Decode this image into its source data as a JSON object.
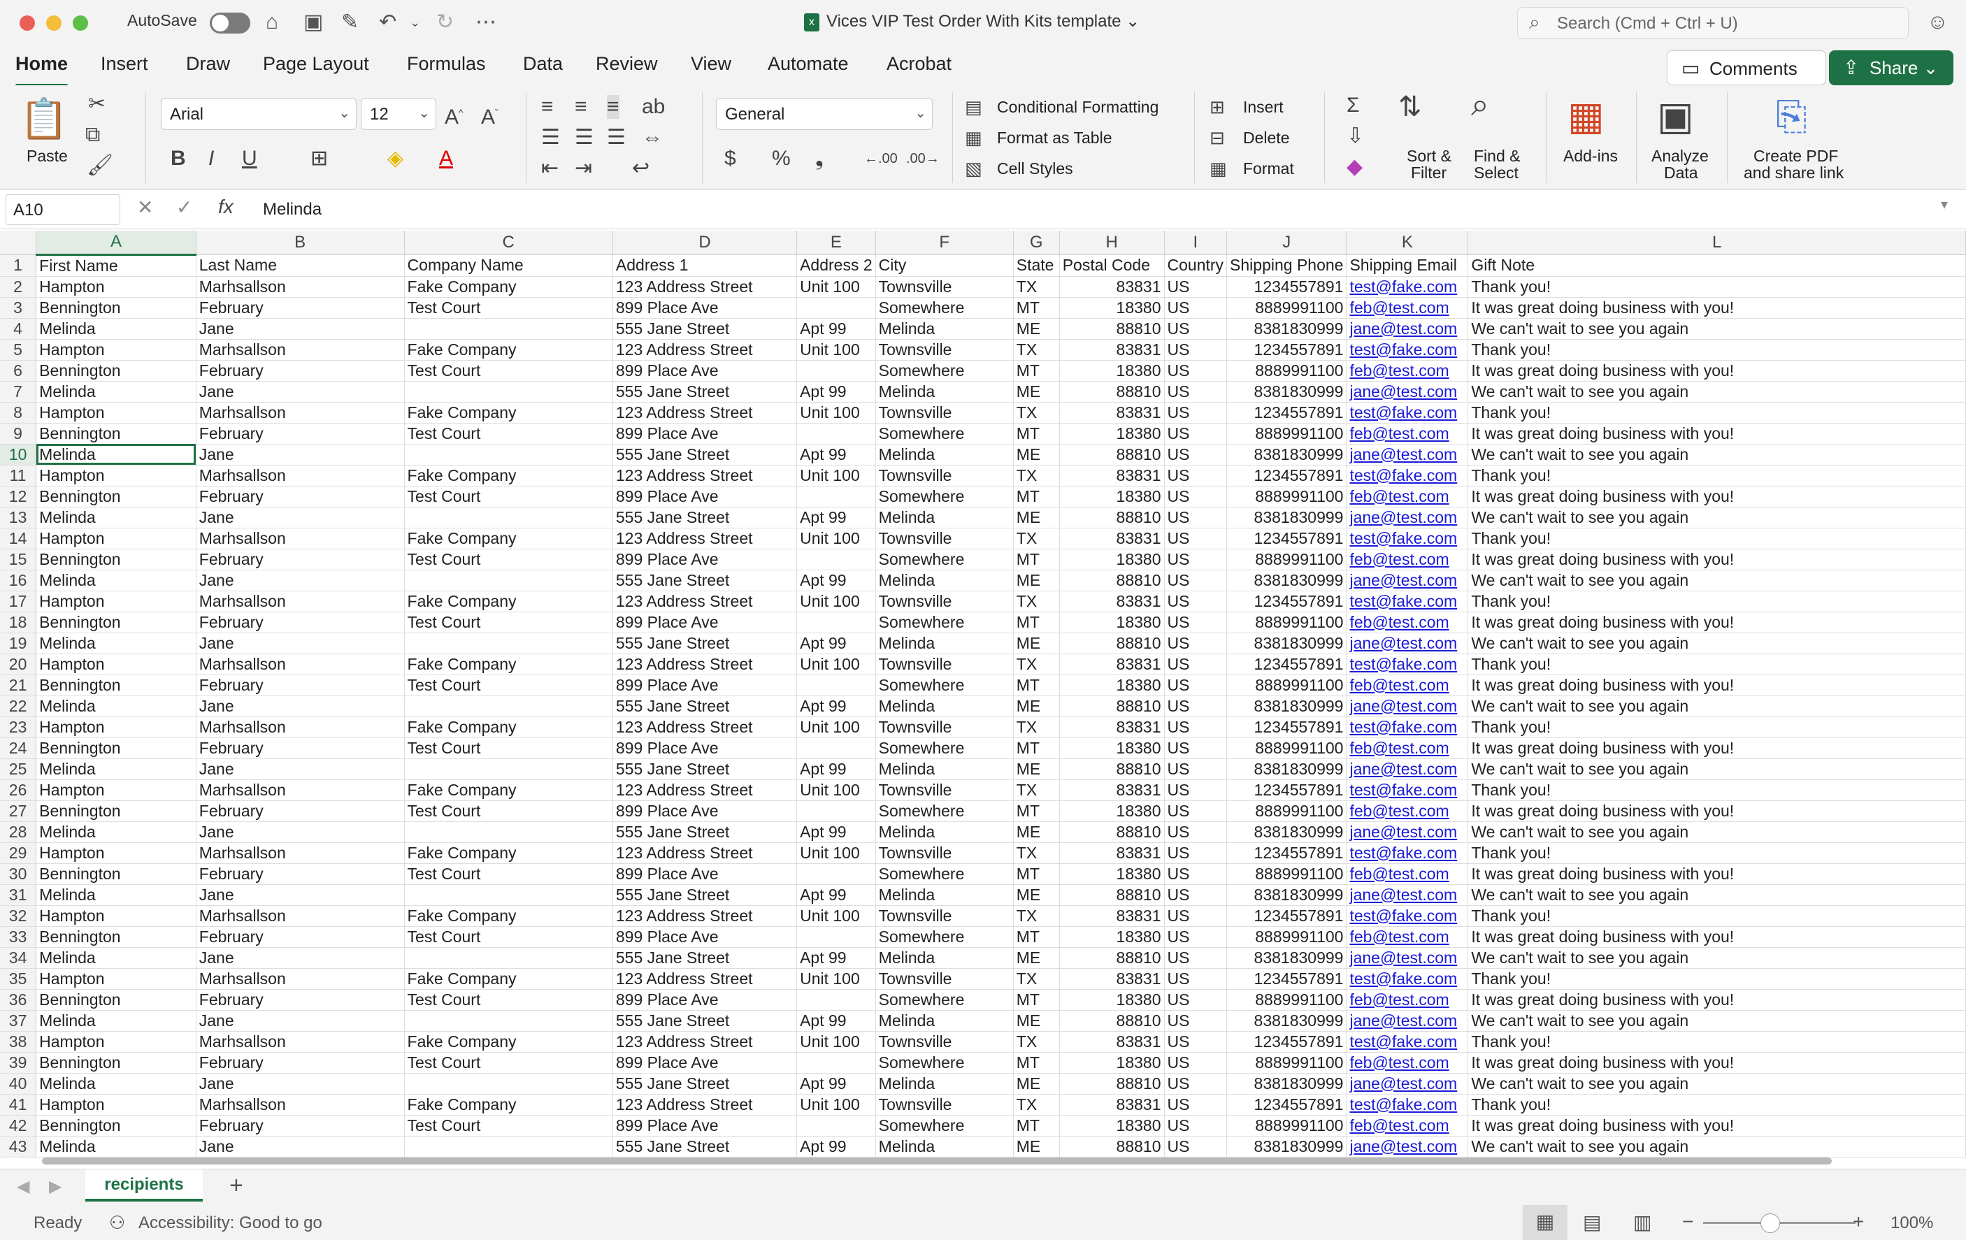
{
  "window": {
    "autosave_label": "AutoSave",
    "title": "Vices VIP Test Order With Kits template",
    "search_placeholder": "Search (Cmd + Ctrl + U)"
  },
  "menu": {
    "tabs": [
      "Home",
      "Insert",
      "Draw",
      "Page Layout",
      "Formulas",
      "Data",
      "Review",
      "View",
      "Automate",
      "Acrobat"
    ],
    "active": "Home",
    "comments_label": "Comments",
    "share_label": "Share"
  },
  "ribbon": {
    "paste_label": "Paste",
    "font_name": "Arial",
    "font_size": "12",
    "number_format": "General",
    "conditional_formatting": "Conditional Formatting",
    "format_as_table": "Format as Table",
    "cell_styles": "Cell Styles",
    "insert": "Insert",
    "delete": "Delete",
    "format": "Format",
    "sort_filter_1": "Sort &",
    "sort_filter_2": "Filter",
    "find_select_1": "Find &",
    "find_select_2": "Select",
    "addins": "Add-ins",
    "analyze_1": "Analyze",
    "analyze_2": "Data",
    "pdf_1": "Create PDF",
    "pdf_2": "and share link"
  },
  "formula_bar": {
    "cell_ref": "A10",
    "value": "Melinda"
  },
  "sheet": {
    "columns": [
      "A",
      "B",
      "C",
      "D",
      "E",
      "F",
      "G",
      "H",
      "I",
      "J",
      "K",
      "L"
    ],
    "headers": [
      "First Name",
      "Last Name",
      "Company Name",
      "Address 1",
      "Address 2",
      "City",
      "State",
      "Postal Code",
      "Country",
      "Shipping Phone",
      "Shipping Email",
      "Gift Note"
    ],
    "record_types": [
      [
        "Hampton",
        "Marhsallson",
        "Fake Company",
        "123 Address Street",
        "Unit 100",
        "Townsville",
        "TX",
        "83831",
        "US",
        "1234557891",
        "test@fake.com",
        "Thank you!"
      ],
      [
        "Bennington",
        "February",
        "Test Court",
        "899 Place Ave",
        "",
        "Somewhere",
        "MT",
        "18380",
        "US",
        "8889991100",
        "feb@test.com",
        "It was great doing business with you!"
      ],
      [
        "Melinda",
        "Jane",
        "",
        "555 Jane Street",
        "Apt 99",
        "Melinda",
        "ME",
        "88810",
        "US",
        "8381830999",
        "jane@test.com",
        "We can't wait to see you again"
      ]
    ],
    "visible_rows": 43,
    "active_row": 10,
    "active_col": "A",
    "tab_name": "recipients"
  },
  "status": {
    "ready": "Ready",
    "accessibility": "Accessibility: Good to go",
    "zoom": "100%"
  },
  "colors": {
    "accent": "#1e7145",
    "link": "#1a1ad8"
  }
}
